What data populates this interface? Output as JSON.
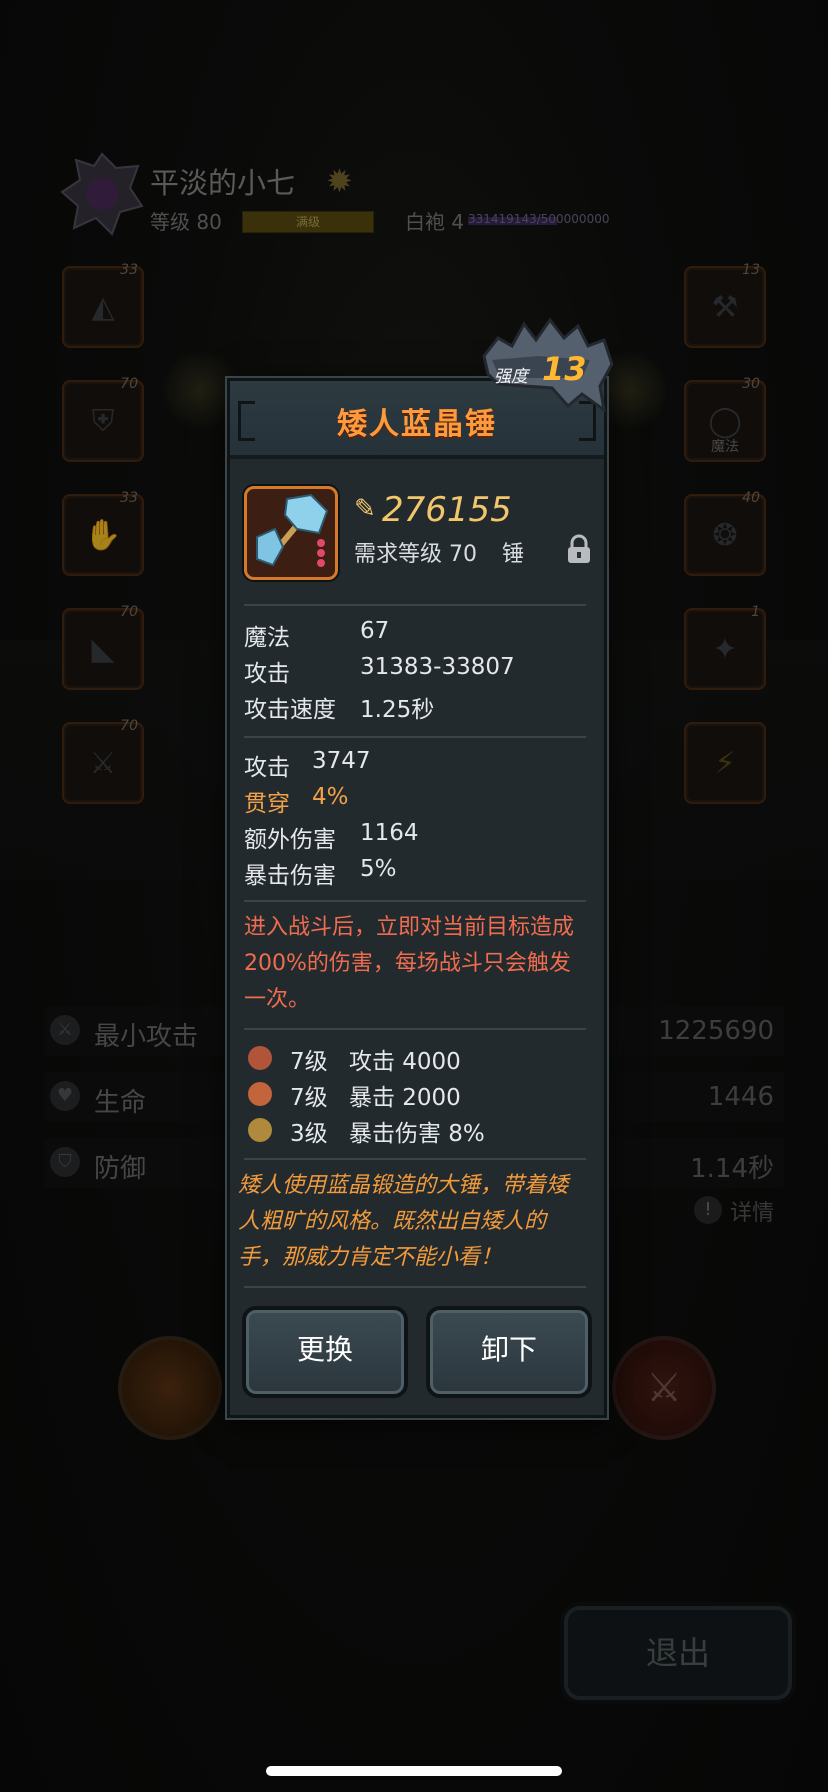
{
  "player": {
    "name": "平淡的小七",
    "level_label": "等级 80",
    "level_bar_text": "满级",
    "level_progress": 1.0,
    "rank_label": "白袍 4",
    "rank_progress_text": "331419143/500000000",
    "rank_progress": 0.663
  },
  "slots": {
    "left": [
      {
        "level": "33",
        "icon": "helmet-icon"
      },
      {
        "level": "70",
        "icon": "armor-icon"
      },
      {
        "level": "33",
        "icon": "gloves-icon"
      },
      {
        "level": "70",
        "icon": "boots-icon"
      },
      {
        "level": "70",
        "icon": "weapon-icon"
      }
    ],
    "right": [
      {
        "level": "13",
        "icon": "hammer-icon"
      },
      {
        "level": "30",
        "icon": "ring-icon",
        "tag": "魔法"
      },
      {
        "level": "40",
        "icon": "amulet-icon"
      },
      {
        "level": "1",
        "icon": "relic-icon"
      },
      {
        "level": "",
        "icon": "lightning-icon"
      }
    ]
  },
  "stats": [
    {
      "label": "最小攻击",
      "value": "1225690",
      "icon": "sword-icon"
    },
    {
      "label": "生命",
      "value": "1446",
      "icon": "heart-icon"
    },
    {
      "label": "防御",
      "value": "1.14秒",
      "icon": "shield-icon"
    }
  ],
  "detail_label": "详情",
  "exit_label": "退出",
  "item": {
    "name": "矮人蓝晶锤",
    "strength_label": "强度",
    "strength": "13",
    "power": "276155",
    "requirement": "需求等级 70",
    "type": "锤",
    "base_stats": [
      {
        "k": "魔法",
        "v": "67"
      },
      {
        "k": "攻击",
        "v": "31383-33807"
      },
      {
        "k": "攻击速度",
        "v": "1.25秒"
      }
    ],
    "bonus_stats": [
      {
        "k": "攻击",
        "v": "3747",
        "highlight": false
      },
      {
        "k": "贯穿",
        "v": "4%",
        "highlight": true
      },
      {
        "k": "额外伤害",
        "v": "1164",
        "highlight": false
      },
      {
        "k": "暴击伤害",
        "v": "5%",
        "highlight": false
      }
    ],
    "effect": "进入战斗后，立即对当前目标造成200%的伤害，每场战斗只会触发一次。",
    "gems": [
      {
        "level": "7级",
        "text": "攻击 4000",
        "color": "#b0553a"
      },
      {
        "level": "7级",
        "text": "暴击 2000",
        "color": "#c2643c"
      },
      {
        "level": "3级",
        "text": "暴击伤害 8%",
        "color": "#b08a3c"
      }
    ],
    "lore": "矮人使用蓝晶锻造的大锤，带着矮人粗旷的风格。既然出自矮人的手，那威力肯定不能小看！"
  },
  "buttons": {
    "replace": "更换",
    "unequip": "卸下"
  },
  "colors": {
    "title": "#ff9a3c",
    "strength": "#ffb830",
    "effect": "#ef6c4f",
    "lore": "#f09a3c",
    "highlight": "#f3a148"
  }
}
